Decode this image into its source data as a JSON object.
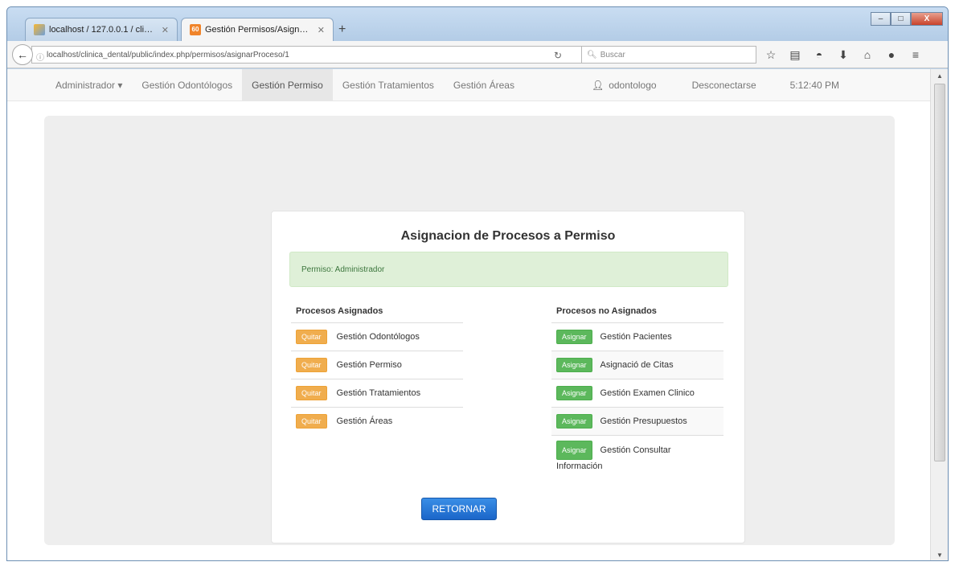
{
  "browser": {
    "tabs": [
      {
        "title": "localhost / 127.0.0.1 / clinic..."
      },
      {
        "title": "Gestión Permisos/Asignar ..."
      }
    ],
    "new_tab": "+",
    "url": "localhost/clinica_dental/public/index.php/permisos/asignarProceso/1",
    "search_placeholder": "Buscar",
    "window_controls": [
      "–",
      "□",
      "X"
    ]
  },
  "appnav": {
    "items": [
      {
        "label": "Administrador ▾"
      },
      {
        "label": "Gestión Odontólogos"
      },
      {
        "label": "Gestión Permiso"
      },
      {
        "label": "Gestión Tratamientos"
      },
      {
        "label": "Gestión Áreas"
      }
    ],
    "user": "odontologo",
    "logout": "Desconectarse",
    "clock": "5:12:40 PM"
  },
  "page": {
    "title": "Asignacion de Procesos a Permiso",
    "alert": "Permiso: Administrador",
    "assigned": {
      "title": "Procesos Asignados",
      "button_label": "Quitar",
      "items": [
        "Gestión Odontólogos",
        "Gestión Permiso",
        "Gestión Tratamientos",
        "Gestión Áreas"
      ]
    },
    "unassigned": {
      "title": "Procesos no Asignados",
      "button_label": "Asignar",
      "items": [
        "Gestión Pacientes",
        "Asignació de Citas",
        "Gestión Examen Clinico",
        "Gestión Presupuestos",
        "Gestión Consultar Información"
      ]
    },
    "return_button": "RETORNAR"
  },
  "colors": {
    "quitar": "#f0ad4e",
    "asignar": "#5cb85c",
    "retornar": "#1b66c9",
    "alert_bg": "#dff0d8"
  }
}
